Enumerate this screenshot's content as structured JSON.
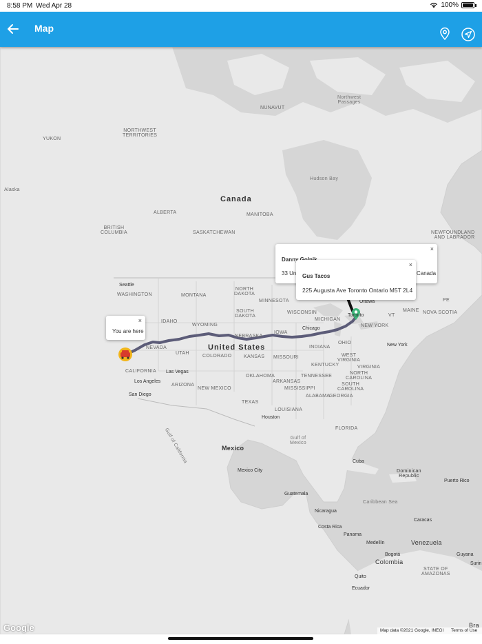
{
  "status_bar": {
    "time": "8:58 PM",
    "date": "Wed Apr 28",
    "battery": "100%"
  },
  "app_bar": {
    "title": "Map"
  },
  "icons": {
    "back": "arrow-back-icon",
    "pin": "map-pin-icon",
    "navigate": "navigation-arrow-icon"
  },
  "map": {
    "regions": {
      "canada": "Canada",
      "united_states": "United States",
      "mexico": "Mexico",
      "nunavut": "NUNAVUT",
      "northwest_territories": "NORTHWEST\nTERRITORIES",
      "yukon": "YUKON",
      "alaska": "Alaska",
      "alberta": "ALBERTA",
      "british_columbia": "BRITISH\nCOLUMBIA",
      "saskatchewan": "SASKATCHEWAN",
      "manitoba": "MANITOBA",
      "newfoundland": "NEWFOUNDLAND\nAND LABRADOR",
      "northwest_passages": "Northwest\nPassages",
      "hudson_bay": "Hudson Bay",
      "washington": "WASHINGTON",
      "montana": "MONTANA",
      "north_dakota": "NORTH\nDAKOTA",
      "minnesota": "MINNESOTA",
      "south_dakota": "SOUTH\nDAKOTA",
      "wisconsin": "WISCONSIN",
      "michigan": "MICHIGAN",
      "idaho": "IDAHO",
      "wyoming": "WYOMING",
      "nebraska": "NEBRASKA",
      "iowa": "IOWA",
      "nevada": "NEVADA",
      "utah": "UTAH",
      "colorado": "COLORADO",
      "kansas": "KANSAS",
      "missouri": "MISSOURI",
      "indiana": "INDIANA",
      "ohio": "OHIO",
      "west_virginia": "WEST\nVIRGINIA",
      "virginia": "VIRGINIA",
      "kentucky": "KENTUCKY",
      "north_carolina": "NORTH\nCAROLINA",
      "tennessee": "TENNESSEE",
      "south_carolina": "SOUTH\nCAROLINA",
      "oklahoma": "OKLAHOMA",
      "arkansas": "ARKANSAS",
      "mississippi": "MISSISSIPPI",
      "alabama": "ALABAMA",
      "georgia": "GEORGIA",
      "texas": "TEXAS",
      "louisiana": "LOUISIANA",
      "california": "CALIFORNIA",
      "arizona": "ARIZONA",
      "new_mexico": "NEW MEXICO",
      "florida": "FLORIDA",
      "pe": "PE",
      "new_york_state": "NEW YORK",
      "maine": "MAINE",
      "vt": "VT",
      "nova_scotia": "NOVA SCOTIA",
      "gulf_of_mexico": "Gulf of\nMexico",
      "gulf_of_california": "Gulf of California",
      "caribbean_sea": "Caribbean Sea",
      "venezuela": "Venezuela",
      "colombia": "Colombia",
      "dominican_republic": "Dominican\nRepublic",
      "state_amazonas": "STATE OF\nAMAZONAS",
      "bra": "Bra"
    },
    "cities": {
      "seattle": "Seattle",
      "las_vegas": "Las Vegas",
      "los_angeles": "Los Angeles",
      "san_diego": "San Diego",
      "chicago": "Chicago",
      "toronto": "Toronto",
      "ottawa": "Ottawa",
      "new_york": "New York",
      "houston": "Houston",
      "mexico_city": "Mexico City",
      "guatemala": "Guatemala",
      "nicaragua": "Nicaragua",
      "costa_rica": "Costa Rica",
      "panama": "Panama",
      "cuba": "Cuba",
      "puerto_rico": "Puerto Rico",
      "caracas": "Caracas",
      "medellin": "Medellín",
      "bogota": "Bogotá",
      "quito": "Quito",
      "ecuador": "Ecuador",
      "guyana": "Guyana",
      "surinam": "Surin"
    },
    "popups": {
      "you_are_here": "You are here",
      "danny_name": "Danny Golnik",
      "danny_address_start": "33 Un",
      "danny_address_end": "Canada",
      "gus_name": "Gus Tacos",
      "gus_address": "225 Augusta Ave Toronto Ontario M5T 2L4"
    },
    "close_glyph": "×",
    "google_logo": "Google",
    "attribution": "Map data ©2021 Google, INEGI",
    "terms": "Terms of Use",
    "route_color": "#5c5c78"
  }
}
